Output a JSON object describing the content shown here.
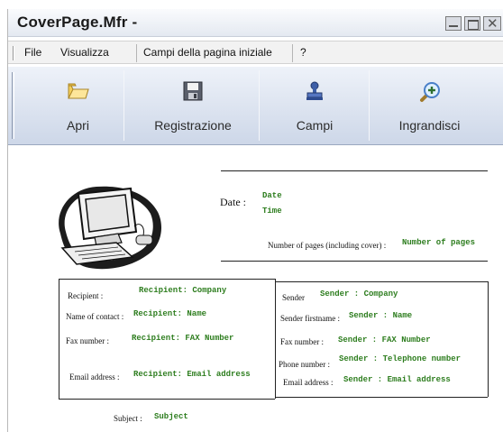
{
  "window": {
    "title": "CoverPage.Mfr -"
  },
  "menu": {
    "file": "File",
    "view": "Visualizza",
    "fields": "Campi della pagina iniziale",
    "help": "?"
  },
  "toolbar": {
    "open": {
      "label": "Apri",
      "icon": "folder-open-icon"
    },
    "save": {
      "label": "Registrazione",
      "icon": "floppy-disk-icon"
    },
    "fields": {
      "label": "Campi",
      "icon": "stamp-icon"
    },
    "zoom": {
      "label": "Ingrandisci",
      "icon": "magnifier-plus-icon"
    }
  },
  "cover": {
    "date_label": "Date :",
    "date_field": "Date",
    "time_field": "Time",
    "pages_label": "Number of pages (including cover) :",
    "pages_field": "Number of pages",
    "recipient": {
      "recipient_label": "Recipient :",
      "recipient_value": "Recipient: Company",
      "name_label": "Name of contact :",
      "name_value": "Recipient: Name",
      "fax_label": "Fax number :",
      "fax_value": "Recipient: FAX Number",
      "email_label": "Email address :",
      "email_value": "Recipient: Email address"
    },
    "sender": {
      "sender_label": "Sender",
      "sender_value": "Sender : Company",
      "name_label": "Sender firstname :",
      "name_value": "Sender : Name",
      "fax_label": "Fax number :",
      "fax_value": "Sender : FAX Number",
      "phone_label": "Phone number :",
      "phone_value": "Sender : Telephone number",
      "email_label": "Email address :",
      "email_value": "Sender : Email address"
    },
    "subject_label": "Subject :",
    "subject_field": "Subject"
  }
}
